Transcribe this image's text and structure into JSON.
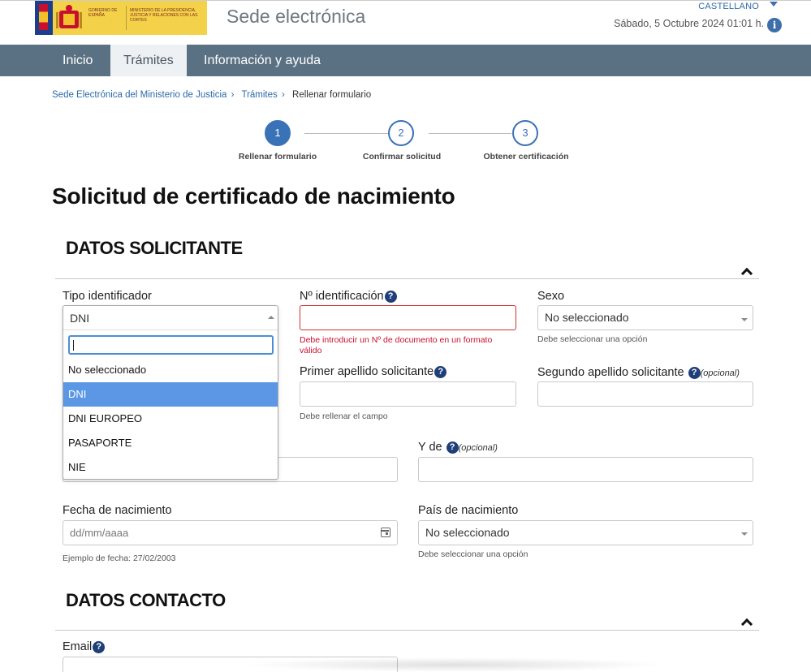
{
  "header": {
    "logo_text_1": "GOBIERNO DE ESPAÑA",
    "logo_text_2": "MINISTERIO DE LA PRESIDENCIA, JUSTICIA Y RELACIONES CON LAS CORTES",
    "site_title": "Sede electrónica",
    "language": "CASTELLANO",
    "datetime": "Sábado, 5 Octubre 2024  01:01 h.",
    "info_icon": "i"
  },
  "nav": {
    "items": [
      {
        "label": "Inicio"
      },
      {
        "label": "Trámites"
      },
      {
        "label": "Información y ayuda"
      }
    ]
  },
  "breadcrumb": {
    "items": [
      "Sede Electrónica del Ministerio de Justicia",
      "Trámites",
      "Rellenar formulario"
    ],
    "separator": "›"
  },
  "stepper": {
    "steps": [
      {
        "number": "1",
        "label": "Rellenar formulario"
      },
      {
        "number": "2",
        "label": "Confirmar solicitud"
      },
      {
        "number": "3",
        "label": "Obtener certificación"
      }
    ]
  },
  "page_title": "Solicitud de certificado de nacimiento",
  "datos_solicitante": {
    "title": "DATOS SOLICITANTE",
    "tipo_identificador": {
      "label": "Tipo identificador",
      "value": "DNI",
      "options": [
        "No seleccionado",
        "DNI",
        "DNI EUROPEO",
        "PASAPORTE",
        "NIE"
      ]
    },
    "n_identificacion": {
      "label": "Nº identificación",
      "error": "Debe introducir un Nº de documento en un formato válido"
    },
    "sexo": {
      "label": "Sexo",
      "value": "No seleccionado",
      "hint": "Debe seleccionar una opción"
    },
    "primer_apellido": {
      "label": "Primer apellido solicitante",
      "hint": "Debe rellenar el campo"
    },
    "segundo_apellido": {
      "label": "Segundo apellido solicitante",
      "optional": "(opcional)"
    },
    "y_de": {
      "label": "Y de",
      "optional": "(opcional)"
    },
    "fecha_nacimiento": {
      "label": "Fecha de nacimiento",
      "placeholder": "dd/mm/aaaa",
      "hint": "Ejemplo de fecha: 27/02/2003"
    },
    "pais_nacimiento": {
      "label": "País de nacimiento",
      "value": "No seleccionado",
      "hint": "Debe seleccionar una opción"
    }
  },
  "datos_contacto": {
    "title": "DATOS CONTACTO",
    "email": {
      "label": "Email"
    }
  },
  "icons": {
    "help": "?",
    "info": "i"
  },
  "colors": {
    "nav_bg": "#5a7183",
    "accent": "#3a72b8",
    "error": "#c8102e",
    "selected_option": "#5b97e5",
    "logo_bg": "#f3d24a"
  }
}
